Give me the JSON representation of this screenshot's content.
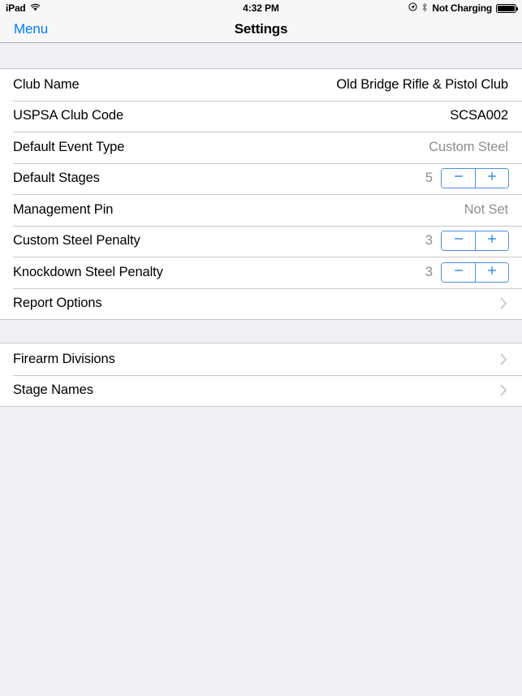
{
  "status_bar": {
    "device": "iPad",
    "wifi_icon": "wifi-icon",
    "time": "4:32 PM",
    "location_icon": "location-services-icon",
    "bluetooth_icon": "bluetooth-icon",
    "battery_text": "Not Charging",
    "battery_icon": "battery-full-icon",
    "battery_level": 100
  },
  "nav_bar": {
    "back_label": "Menu",
    "title": "Settings"
  },
  "colors": {
    "accent_blue": "#007AFF",
    "stepper_blue": "#4A90E2",
    "muted_gray": "#8E8E93",
    "separator": "#C8C7CC",
    "group_background": "#EFEFF4",
    "bar_background": "#F7F7F8"
  },
  "sections": [
    {
      "rows": [
        {
          "label": "Club Name",
          "type": "value",
          "value": "Old Bridge Rifle & Pistol Club",
          "value_style": "dark"
        },
        {
          "label": "USPSA Club Code",
          "type": "value",
          "value": "SCSA002",
          "value_style": "dark"
        },
        {
          "label": "Default Event Type",
          "type": "value",
          "value": "Custom Steel",
          "value_style": "muted"
        },
        {
          "label": "Default Stages",
          "type": "stepper",
          "value": "5",
          "decrement_label": "−",
          "increment_label": "+"
        },
        {
          "label": "Management Pin",
          "type": "value",
          "value": "Not Set",
          "value_style": "muted"
        },
        {
          "label": "Custom Steel Penalty",
          "type": "stepper",
          "value": "3",
          "decrement_label": "−",
          "increment_label": "+"
        },
        {
          "label": "Knockdown Steel Penalty",
          "type": "stepper",
          "value": "3",
          "decrement_label": "−",
          "increment_label": "+"
        },
        {
          "label": "Report Options",
          "type": "disclosure"
        }
      ]
    },
    {
      "rows": [
        {
          "label": "Firearm Divisions",
          "type": "disclosure"
        },
        {
          "label": "Stage Names",
          "type": "disclosure"
        }
      ]
    }
  ]
}
